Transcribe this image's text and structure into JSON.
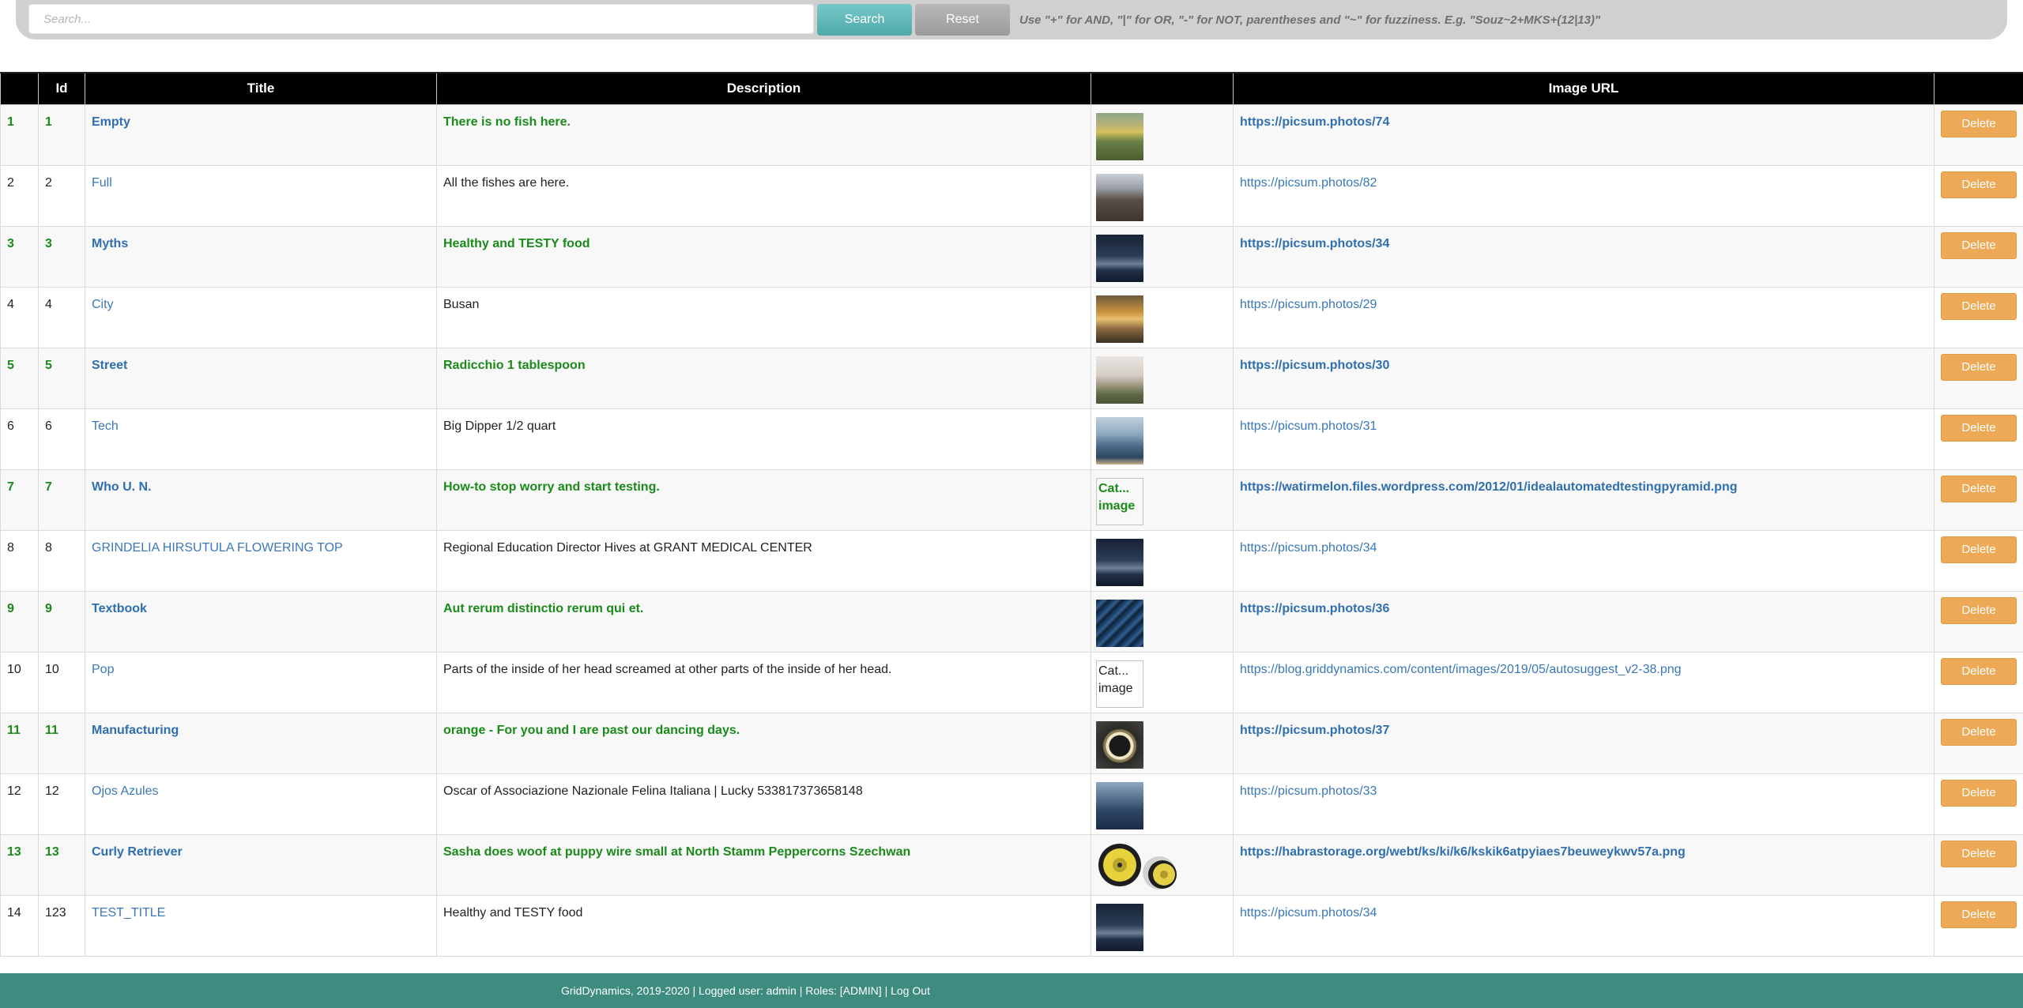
{
  "search": {
    "placeholder": "Search...",
    "search_label": "Search",
    "reset_label": "Reset",
    "hint": "Use \"+\" for AND, \"|\" for OR, \"-\" for NOT, parentheses and \"~\" for fuzziness. E.g. \"Souz~2+MKS+(12|13)\""
  },
  "table": {
    "columns": [
      "",
      "Id",
      "Title",
      "Description",
      "",
      "Image URL",
      ""
    ],
    "delete_label": "Delete",
    "broken_alt": "Cat... image",
    "rows": [
      {
        "n": "1",
        "id": "1",
        "title": "Empty",
        "description": "There is no fish here.",
        "url": "https://picsum.photos/74",
        "img": "flower",
        "hl": true
      },
      {
        "n": "2",
        "id": "2",
        "title": "Full",
        "description": "All the fishes are here.",
        "url": "https://picsum.photos/82",
        "img": "crowd",
        "hl": false
      },
      {
        "n": "3",
        "id": "3",
        "title": "Myths",
        "description": "Healthy and TESTY food",
        "url": "https://picsum.photos/34",
        "img": "night",
        "hl": true
      },
      {
        "n": "4",
        "id": "4",
        "title": "City",
        "description": "Busan",
        "url": "https://picsum.photos/29",
        "img": "sunset",
        "hl": false
      },
      {
        "n": "5",
        "id": "5",
        "title": "Street",
        "description": "Radicchio 1 tablespoon",
        "url": "https://picsum.photos/30",
        "img": "haze",
        "hl": true
      },
      {
        "n": "6",
        "id": "6",
        "title": "Tech",
        "description": "Big Dipper 1/2 quart",
        "url": "https://picsum.photos/31",
        "img": "sea",
        "hl": false
      },
      {
        "n": "7",
        "id": "7",
        "title": "Who U. N.",
        "description": "How-to stop worry and start testing.",
        "url": "https://watirmelon.files.wordpress.com/2012/01/idealautomatedtestingpyramid.png",
        "img": "broken",
        "hl": true
      },
      {
        "n": "8",
        "id": "8",
        "title": "GRINDELIA HIRSUTULA FLOWERING TOP",
        "description": "Regional Education Director Hives at GRANT MEDICAL CENTER",
        "url": "https://picsum.photos/34",
        "img": "night",
        "hl": false
      },
      {
        "n": "9",
        "id": "9",
        "title": "Textbook",
        "description": "Aut rerum distinctio rerum qui et.",
        "url": "https://picsum.photos/36",
        "img": "waves",
        "hl": true
      },
      {
        "n": "10",
        "id": "10",
        "title": "Pop",
        "description": "Parts of the inside of her head screamed at other parts of the inside of her head.",
        "url": "https://blog.griddynamics.com/content/images/2019/05/autosuggest_v2-38.png",
        "img": "broken",
        "hl": false
      },
      {
        "n": "11",
        "id": "11",
        "title": "Manufacturing",
        "description": "orange - For you and I are past our dancing days.",
        "url": "https://picsum.photos/37",
        "img": "ring",
        "hl": true
      },
      {
        "n": "12",
        "id": "12",
        "title": "Ojos Azules",
        "description": "Oscar of Associazione Nazionale Felina Italiana | Lucky 533817373658148",
        "url": "https://picsum.photos/33",
        "img": "forest",
        "hl": false
      },
      {
        "n": "13",
        "id": "13",
        "title": "Curly Retriever",
        "description": "Sasha does woof at puppy wire small at North Stamm Peppercorns Szechwan",
        "url": "https://habrastorage.org/webt/ks/ki/k6/kskik6atpyiaes7beuweykwv57a.png",
        "img": "discs",
        "hl": true
      },
      {
        "n": "14",
        "id": "123",
        "title": "TEST_TITLE",
        "description": "Healthy and TESTY food",
        "url": "https://picsum.photos/34",
        "img": "night",
        "hl": false
      }
    ]
  },
  "footer": {
    "text": "GridDynamics, 2019-2020 | Logged user: admin | Roles: [ADMIN] | Log Out"
  }
}
